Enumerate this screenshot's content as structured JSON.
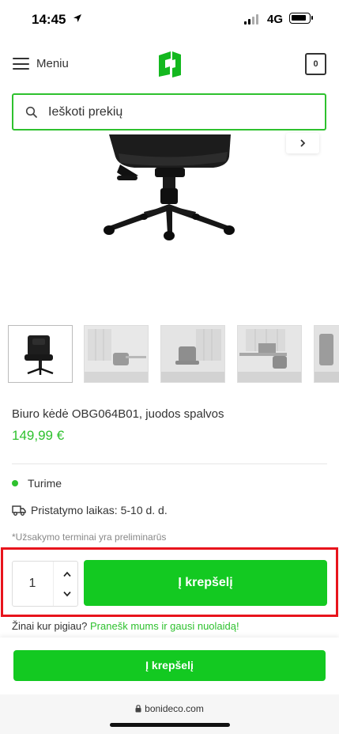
{
  "status_bar": {
    "time": "14:45",
    "network": "4G"
  },
  "header": {
    "menu_label": "Meniu",
    "cart_count": "0"
  },
  "search": {
    "placeholder": "Ieškoti prekių"
  },
  "product": {
    "name": "Biuro kėdė OBG064B01, juodos spalvos",
    "price": "149,99 €",
    "stock": "Turime",
    "delivery": "Pristatymo laikas: 5-10 d. d.",
    "note": "*Užsakymo terminai yra preliminarūs"
  },
  "purchase": {
    "quantity": "1",
    "add_label": "Į krepšelį",
    "cheaper_text": "Žinai kur pigiau?",
    "cheaper_link": "Pranešk mums ir gausi nuolaidą!"
  },
  "sticky": {
    "add_label": "Į krepšelį"
  },
  "browser": {
    "url": "bonideco.com"
  },
  "colors": {
    "accent": "#13c921",
    "highlight": "#e8141c"
  }
}
